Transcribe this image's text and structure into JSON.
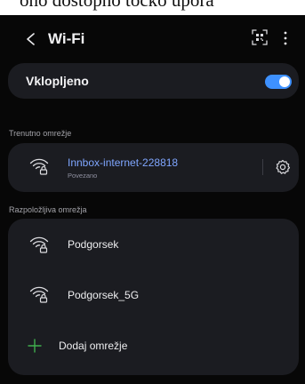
{
  "top_fragment": "ono dostopno točko upora",
  "header": {
    "back_icon": "chevron-left-icon",
    "title": "Wi-Fi",
    "qr_icon": "qr-scan-icon",
    "menu_icon": "more-vertical-icon"
  },
  "wifi_toggle": {
    "label": "Vklopljeno",
    "on": true,
    "accent": "#3e91ff"
  },
  "current_network": {
    "section_title": "Trenutno omrežje",
    "name": "Innbox-internet-228818",
    "status": "Povezano",
    "icon": "wifi-lock-icon",
    "settings_icon": "gear-icon",
    "name_color": "#7fa6ff"
  },
  "available_networks": {
    "section_title": "Razpoložljiva omrežja",
    "items": [
      {
        "name": "Podgorsek",
        "icon": "wifi-lock-icon"
      },
      {
        "name": "Podgorsek_5G",
        "icon": "wifi-lock-icon"
      }
    ],
    "add": {
      "label": "Dodaj omrežje",
      "icon": "plus-icon",
      "icon_color": "#3fae4d"
    }
  }
}
